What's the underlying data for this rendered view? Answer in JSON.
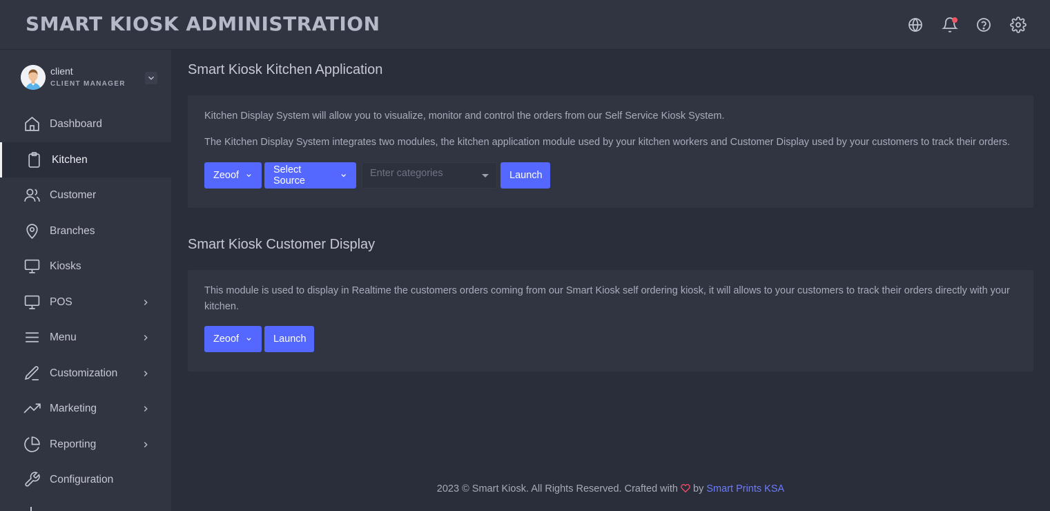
{
  "header": {
    "brand": "SMART KIOSK ADMINISTRATION",
    "icons": [
      "globe-icon",
      "bell-icon",
      "help-icon",
      "gear-icon"
    ]
  },
  "user": {
    "name": "client",
    "role": "CLIENT MANAGER"
  },
  "sidebar": {
    "items": [
      {
        "label": "Dashboard",
        "icon": "home-icon",
        "active": false,
        "has_submenu": false
      },
      {
        "label": "Kitchen",
        "icon": "clipboard-icon",
        "active": true,
        "has_submenu": false
      },
      {
        "label": "Customer",
        "icon": "users-icon",
        "active": false,
        "has_submenu": false
      },
      {
        "label": "Branches",
        "icon": "map-pin-icon",
        "active": false,
        "has_submenu": false
      },
      {
        "label": "Kiosks",
        "icon": "monitor-icon",
        "active": false,
        "has_submenu": false
      },
      {
        "label": "POS",
        "icon": "monitor-icon",
        "active": false,
        "has_submenu": true
      },
      {
        "label": "Menu",
        "icon": "menu-icon",
        "active": false,
        "has_submenu": true
      },
      {
        "label": "Customization",
        "icon": "edit-icon",
        "active": false,
        "has_submenu": true
      },
      {
        "label": "Marketing",
        "icon": "trending-up-icon",
        "active": false,
        "has_submenu": true
      },
      {
        "label": "Reporting",
        "icon": "pie-chart-icon",
        "active": false,
        "has_submenu": true
      },
      {
        "label": "Configuration",
        "icon": "wrench-icon",
        "active": false,
        "has_submenu": false
      }
    ]
  },
  "kitchen": {
    "title": "Smart Kiosk Kitchen Application",
    "desc1": "Kitchen Display System will allow you to visualize, monitor and control the orders from our Self Service Kiosk System.",
    "desc2": "The Kitchen Display System integrates two modules, the kitchen application module used by your kitchen workers and Customer Display used by your customers to track their orders.",
    "branch_label": "Zeoof",
    "source_label": "Select Source",
    "categories_placeholder": "Enter categories",
    "launch_label": "Launch"
  },
  "customer_display": {
    "title": "Smart Kiosk Customer Display",
    "desc_line1": "This module is used to display in Realtime the customers orders coming from our Smart Kiosk self ordering kiosk, it will allows to your customers to track their orders directly with your",
    "desc_line2": "kitchen.",
    "branch_label": "Zeoof",
    "launch_label": "Launch"
  },
  "footer": {
    "text_before": "2023 © Smart Kiosk. All Rights Reserved. Crafted with",
    "text_by": "by",
    "link_text": "Smart Prints KSA"
  },
  "colors": {
    "accent": "#5468ff",
    "background": "#2a2e3b",
    "panel": "#313542",
    "heart": "#ef4d62",
    "notification": "#ef5766"
  }
}
